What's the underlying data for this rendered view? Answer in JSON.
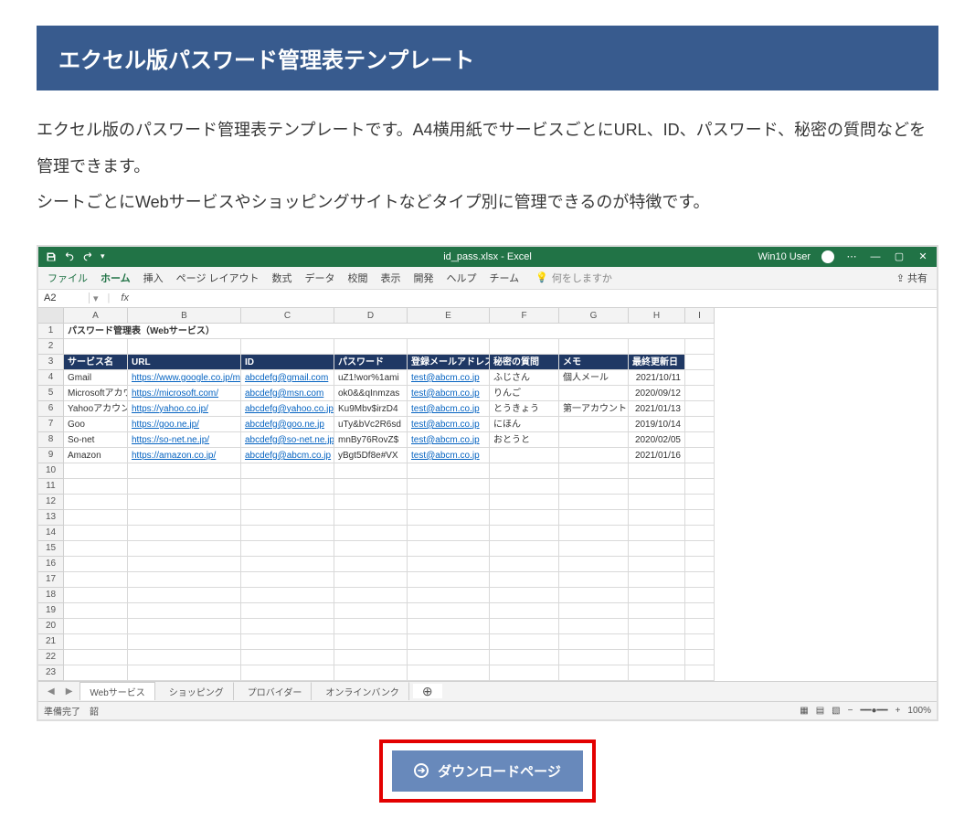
{
  "title": "エクセル版パスワード管理表テンプレート",
  "desc_p1": "エクセル版のパスワード管理表テンプレートです。A4横用紙でサービスごとにURL、ID、パスワード、秘密の質問などを管理できます。",
  "desc_p2": "シートごとにWebサービスやショッピングサイトなどタイプ別に管理できるのが特徴です。",
  "excel": {
    "filename": "id_pass.xlsx - Excel",
    "user": "Win10 User",
    "ribbon": {
      "file": "ファイル",
      "tabs": [
        "ホーム",
        "挿入",
        "ページ レイアウト",
        "数式",
        "データ",
        "校閲",
        "表示",
        "開発",
        "ヘルプ",
        "チーム"
      ],
      "tell": "何をしますか",
      "share": "共有"
    },
    "namebox": "A2",
    "fx": "fx",
    "colLetters": [
      "A",
      "B",
      "C",
      "D",
      "E",
      "F",
      "G",
      "H",
      "I"
    ],
    "sheetTitleRow": "1",
    "sheetTitle": "パスワード管理表（Webサービス）",
    "headerRowNum": "3",
    "headers": [
      "サービス名",
      "URL",
      "ID",
      "パスワード",
      "登録メールアドレス",
      "秘密の質問",
      "メモ",
      "最終更新日"
    ],
    "emptyRow2": "2",
    "rows": [
      {
        "n": "4",
        "service": "Gmail",
        "url": "https://www.google.co.jp/mail/",
        "id": "abcdefg@gmail.com",
        "pw": "uZ1!wor%1ami",
        "mail": "test@abcm.co.jp",
        "q": "ふじさん",
        "memo": "個人メール",
        "date": "2021/10/11"
      },
      {
        "n": "5",
        "service": "Microsoftアカウント",
        "url": "https://microsoft.com/",
        "id": "abcdefg@msn.com",
        "pw": "ok0&&qInmzas",
        "mail": "test@abcm.co.jp",
        "q": "りんご",
        "memo": "",
        "date": "2020/09/12"
      },
      {
        "n": "6",
        "service": "Yahooアカウント",
        "url": "https://yahoo.co.jp/",
        "id": "abcdefg@yahoo.co.jp",
        "pw": "Ku9Mbv$irzD4",
        "mail": "test@abcm.co.jp",
        "q": "とうきょう",
        "memo": "第一アカウント",
        "date": "2021/01/13"
      },
      {
        "n": "7",
        "service": "Goo",
        "url": "https://goo.ne.jp/",
        "id": "abcdefg@goo.ne.jp",
        "pw": "uTy&bVc2R6sd",
        "mail": "test@abcm.co.jp",
        "q": "にほん",
        "memo": "",
        "date": "2019/10/14"
      },
      {
        "n": "8",
        "service": "So-net",
        "url": "https://so-net.ne.jp/",
        "id": "abcdefg@so-net.ne.jp",
        "pw": "mnBy76RovZ$",
        "mail": "test@abcm.co.jp",
        "q": "おとうと",
        "memo": "",
        "date": "2020/02/05"
      },
      {
        "n": "9",
        "service": "Amazon",
        "url": "https://amazon.co.jp/",
        "id": "abcdefg@abcm.co.jp",
        "pw": "yBgt5Df8e#VX",
        "mail": "test@abcm.co.jp",
        "q": "",
        "memo": "",
        "date": "2021/01/16"
      }
    ],
    "emptyRowNums": [
      "10",
      "11",
      "12",
      "13",
      "14",
      "15",
      "16",
      "17",
      "18",
      "19",
      "20",
      "21",
      "22",
      "23"
    ],
    "sheetTabs": [
      "Webサービス",
      "ショッピング",
      "プロバイダー",
      "オンラインバンク"
    ],
    "status": {
      "ready": "準備完了",
      "ext": "韶",
      "zoom": "100%"
    }
  },
  "download": {
    "label": "ダウンロードページ"
  }
}
